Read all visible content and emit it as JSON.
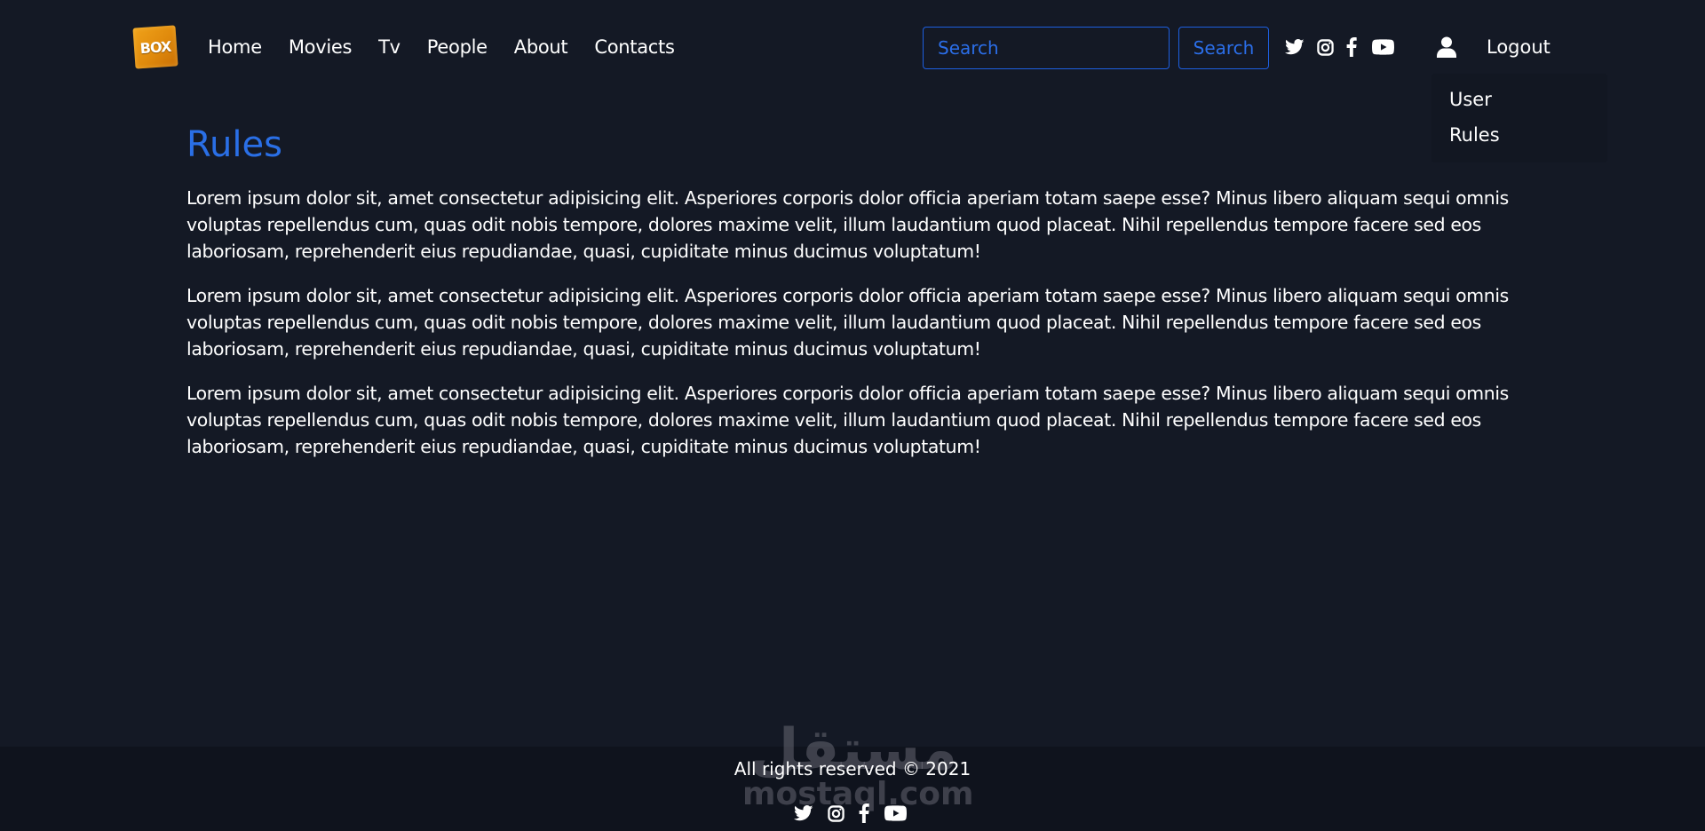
{
  "brand": {
    "logo_text": "BOX"
  },
  "nav": {
    "links": [
      "Home",
      "Movies",
      "Tv",
      "People",
      "About",
      "Contacts"
    ]
  },
  "search": {
    "placeholder": "Search",
    "button_label": "Search"
  },
  "social_icons": [
    "twitter-icon",
    "instagram-icon",
    "facebook-icon",
    "youtube-icon"
  ],
  "account": {
    "logout_label": "Logout",
    "dropdown": [
      "User",
      "Rules"
    ]
  },
  "main": {
    "title": "Rules",
    "paragraphs": [
      "Lorem ipsum dolor sit, amet consectetur adipisicing elit. Asperiores corporis dolor officia aperiam totam saepe esse? Minus libero aliquam sequi omnis voluptas repellendus cum, quas odit nobis tempore, dolores maxime velit, illum laudantium quod placeat. Nihil repellendus tempore facere sed eos laboriosam, reprehenderit eius repudiandae, quasi, cupiditate minus ducimus voluptatum!",
      "Lorem ipsum dolor sit, amet consectetur adipisicing elit. Asperiores corporis dolor officia aperiam totam saepe esse? Minus libero aliquam sequi omnis voluptas repellendus cum, quas odit nobis tempore, dolores maxime velit, illum laudantium quod placeat. Nihil repellendus tempore facere sed eos laboriosam, reprehenderit eius repudiandae, quasi, cupiditate minus ducimus voluptatum!",
      "Lorem ipsum dolor sit, amet consectetur adipisicing elit. Asperiores corporis dolor officia aperiam totam saepe esse? Minus libero aliquam sequi omnis voluptas repellendus cum, quas odit nobis tempore, dolores maxime velit, illum laudantium quod placeat. Nihil repellendus tempore facere sed eos laboriosam, reprehenderit eius repudiandae, quasi, cupiditate minus ducimus voluptatum!"
    ]
  },
  "footer": {
    "copyright": "All rights reserved © 2021"
  },
  "watermark": {
    "arabic": "مستقل",
    "latin": "mostaql.com"
  },
  "colors": {
    "background": "#141925",
    "accent": "#2a6fe6",
    "footer_bg": "#0f131d",
    "logo": "#e8940f"
  }
}
